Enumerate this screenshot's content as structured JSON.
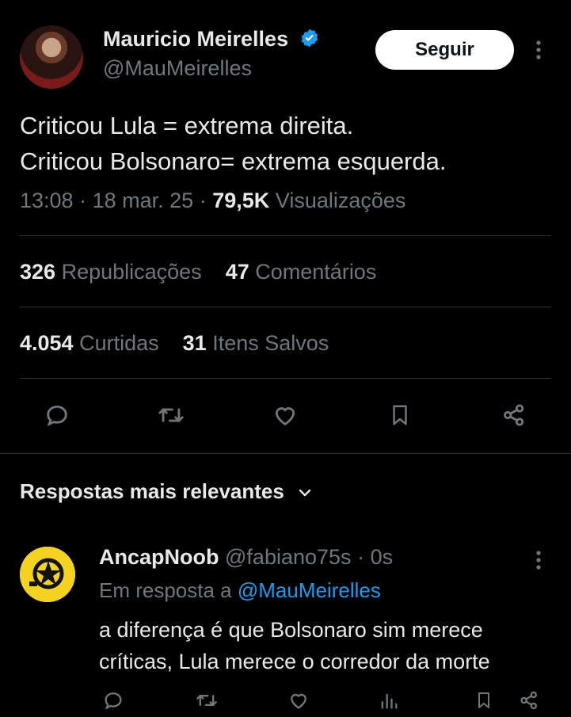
{
  "author": {
    "name": "Mauricio Meirelles",
    "handle": "@MauMeirelles",
    "follow_label": "Seguir"
  },
  "tweet": {
    "text": "Criticou Lula = extrema direita.\nCriticou Bolsonaro= extrema esquerda.",
    "time": "13:08",
    "date": "18 mar. 25",
    "views": "79,5K",
    "views_label": "Visualizações",
    "separator": "·"
  },
  "stats": {
    "reposts": "326",
    "reposts_label": "Republicações",
    "comments": "47",
    "comments_label": "Comentários",
    "likes": "4.054",
    "likes_label": "Curtidas",
    "saves": "31",
    "saves_label": "Itens Salvos"
  },
  "actions": [
    "reply-icon",
    "repost-icon",
    "like-icon",
    "bookmark-icon",
    "share-icon"
  ],
  "replies_section": {
    "title": "Respostas mais relevantes"
  },
  "reply": {
    "name": "AncapNoob",
    "handle": "@fabiano75s",
    "time": "0s",
    "in_reply_prefix": "Em resposta a",
    "in_reply_handle": "@MauMeirelles",
    "text": "a diferença é que Bolsonaro sim merece\ncríticas, Lula merece o corredor da morte"
  },
  "colors": {
    "background": "#000000",
    "text": "#e7e9ea",
    "muted": "#71767b",
    "link": "#1d9bf0",
    "verified": "#1d9bf0",
    "divider": "#2f3336"
  }
}
